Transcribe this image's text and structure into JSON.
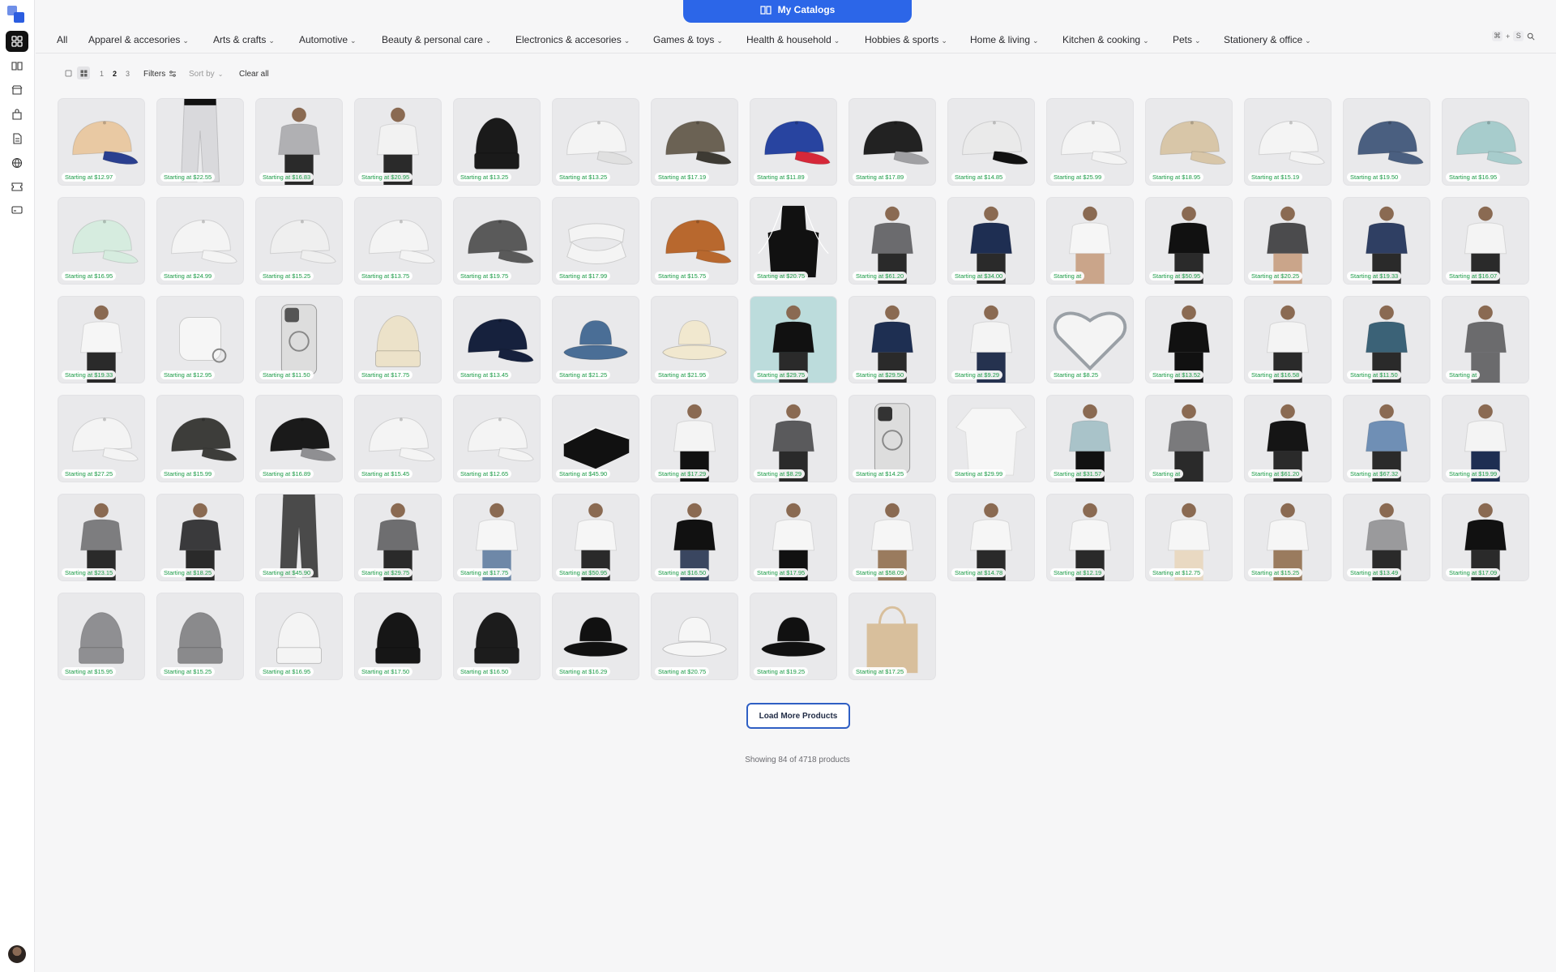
{
  "app": {
    "catalog_button": "My Catalogs"
  },
  "sidebar": {
    "icons": [
      "grid-icon",
      "book-icon",
      "store-icon",
      "bag-icon",
      "document-icon",
      "globe-icon",
      "ticket-icon",
      "card-icon"
    ],
    "active": "grid-icon"
  },
  "nav": {
    "categories": [
      {
        "label": "All",
        "dropdown": false
      },
      {
        "label": "Apparel & accesories",
        "dropdown": true
      },
      {
        "label": "Arts & crafts",
        "dropdown": true
      },
      {
        "label": "Automotive",
        "dropdown": true
      },
      {
        "label": "Beauty & personal care",
        "dropdown": true
      },
      {
        "label": "Electronics & accesories",
        "dropdown": true
      },
      {
        "label": "Games & toys",
        "dropdown": true
      },
      {
        "label": "Health & household",
        "dropdown": true
      },
      {
        "label": "Hobbies & sports",
        "dropdown": true
      },
      {
        "label": "Home & living",
        "dropdown": true
      },
      {
        "label": "Kitchen & cooking",
        "dropdown": true
      },
      {
        "label": "Pets",
        "dropdown": true
      },
      {
        "label": "Stationery & office",
        "dropdown": true
      }
    ],
    "shortcut": [
      "⌘",
      "+",
      "S"
    ]
  },
  "toolbar": {
    "pages": [
      "1",
      "2",
      "3"
    ],
    "active_page": "2",
    "filters_label": "Filters",
    "sort_label": "Sort by",
    "clear_label": "Clear all"
  },
  "products": [
    {
      "price": "Starting at $12.97",
      "kind": "cap",
      "c1": "#e9c9a3",
      "c2": "#2a3f8f"
    },
    {
      "price": "Starting at $22.55",
      "kind": "pants",
      "c1": "#d9d9dc",
      "c2": "#111"
    },
    {
      "price": "Starting at $16.83",
      "kind": "person",
      "c1": "#b0b0b3",
      "c2": "#2a2a2a"
    },
    {
      "price": "Starting at $20.95",
      "kind": "person",
      "c1": "#f2f2f2",
      "c2": "#2a2a2a"
    },
    {
      "price": "Starting at $13.25",
      "kind": "beanie",
      "c1": "#1a1a1a",
      "c2": "#1a1a1a"
    },
    {
      "price": "Starting at $13.25",
      "kind": "cap",
      "c1": "#f4f4f4",
      "c2": "#e0e0e0"
    },
    {
      "price": "Starting at $17.19",
      "kind": "cap",
      "c1": "#6b6254",
      "c2": "#3d3a33"
    },
    {
      "price": "Starting at $11.89",
      "kind": "cap",
      "c1": "#2844a0",
      "c2": "#d62839"
    },
    {
      "price": "Starting at $17.89",
      "kind": "cap",
      "c1": "#222",
      "c2": "#a0a0a3"
    },
    {
      "price": "Starting at $14.85",
      "kind": "cap",
      "c1": "#eaeaea",
      "c2": "#111"
    },
    {
      "price": "Starting at $25.99",
      "kind": "cap",
      "c1": "#f4f4f4",
      "c2": "#f4f4f4"
    },
    {
      "price": "Starting at $18.95",
      "kind": "cap",
      "c1": "#d8c6a8",
      "c2": "#d8c6a8"
    },
    {
      "price": "Starting at $15.19",
      "kind": "cap",
      "c1": "#f4f4f4",
      "c2": "#f4f4f4"
    },
    {
      "price": "Starting at $19.50",
      "kind": "cap",
      "c1": "#4a5f80",
      "c2": "#4a5f80"
    },
    {
      "price": "Starting at $16.95",
      "kind": "cap",
      "c1": "#a7cccc",
      "c2": "#a7cccc"
    },
    {
      "price": "Starting at $16.95",
      "kind": "cap",
      "c1": "#d6ecdf",
      "c2": "#d6ecdf"
    },
    {
      "price": "Starting at $24.99",
      "kind": "cap",
      "c1": "#f4f4f4",
      "c2": "#f4f4f4"
    },
    {
      "price": "Starting at $15.25",
      "kind": "cap",
      "c1": "#efefef",
      "c2": "#efefef"
    },
    {
      "price": "Starting at $13.75",
      "kind": "cap",
      "c1": "#f4f4f4",
      "c2": "#f4f4f4"
    },
    {
      "price": "Starting at $19.75",
      "kind": "cap",
      "c1": "#5a5a5a",
      "c2": "#5a5a5a"
    },
    {
      "price": "Starting at $17.99",
      "kind": "visor",
      "c1": "#f4f4f4",
      "c2": "#f4f4f4"
    },
    {
      "price": "Starting at $15.75",
      "kind": "cap",
      "c1": "#b8682e",
      "c2": "#b8682e"
    },
    {
      "price": "Starting at $20.75",
      "kind": "apron",
      "c1": "#111",
      "c2": "#111"
    },
    {
      "price": "Starting at $61.20",
      "kind": "person",
      "c1": "#6b6b6e",
      "c2": "#2a2a2a"
    },
    {
      "price": "Starting at $34.00",
      "kind": "person",
      "c1": "#1e2e52",
      "c2": "#2a2a2a"
    },
    {
      "price": "Starting at",
      "kind": "person",
      "c1": "#f6f6f6",
      "c2": "#caa58a"
    },
    {
      "price": "Starting at $50.95",
      "kind": "person",
      "c1": "#111",
      "c2": "#2a2a2a"
    },
    {
      "price": "Starting at $20.25",
      "kind": "person",
      "c1": "#4b4b4d",
      "c2": "#caa58a"
    },
    {
      "price": "Starting at $19.33",
      "kind": "person",
      "c1": "#2f3f63",
      "c2": "#2a2a2a"
    },
    {
      "price": "Starting at $16.07",
      "kind": "person",
      "c1": "#f4f4f4",
      "c2": "#2a2a2a"
    },
    {
      "price": "Starting at $19.33",
      "kind": "person",
      "c1": "#f6f6f6",
      "c2": "#2a2a2a"
    },
    {
      "price": "Starting at $12.95",
      "kind": "case",
      "c1": "#f6f6f6",
      "c2": "#f6f6f6"
    },
    {
      "price": "Starting at $11.50",
      "kind": "phone",
      "c1": "#555",
      "c2": "#ddd"
    },
    {
      "price": "Starting at $17.75",
      "kind": "beanie",
      "c1": "#ece2c9",
      "c2": "#ece2c9"
    },
    {
      "price": "Starting at $13.45",
      "kind": "cap",
      "c1": "#16213d",
      "c2": "#16213d"
    },
    {
      "price": "Starting at $21.25",
      "kind": "bucket",
      "c1": "#4a6e96",
      "c2": "#4a6e96"
    },
    {
      "price": "Starting at $21.95",
      "kind": "bucket",
      "c1": "#f1e8cf",
      "c2": "#f1e8cf"
    },
    {
      "price": "Starting at $29.75",
      "kind": "person",
      "c1": "#111",
      "c2": "#2a2a2a",
      "bg": "#bcdcdc"
    },
    {
      "price": "Starting at $29.50",
      "kind": "person",
      "c1": "#1e2f52",
      "c2": "#2a2a2a"
    },
    {
      "price": "Starting at $9.29",
      "kind": "person",
      "c1": "#f4f4f4",
      "c2": "#25324f"
    },
    {
      "price": "Starting at $8.25",
      "kind": "heart",
      "c1": "#f4f4f4",
      "c2": "#9aa0a6"
    },
    {
      "price": "Starting at $13.52",
      "kind": "person",
      "c1": "#111",
      "c2": "#111"
    },
    {
      "price": "Starting at $16.58",
      "kind": "person",
      "c1": "#f4f4f4",
      "c2": "#2a2a2a"
    },
    {
      "price": "Starting at $11.50",
      "kind": "person",
      "c1": "#3b6277",
      "c2": "#2a2a2a"
    },
    {
      "price": "Starting at",
      "kind": "person",
      "c1": "#6b6b6d",
      "c2": "#6b6b6d"
    },
    {
      "price": "Starting at $27.25",
      "kind": "cap",
      "c1": "#f4f4f4",
      "c2": "#f4f4f4"
    },
    {
      "price": "Starting at $15.99",
      "kind": "cap",
      "c1": "#3d3d3a",
      "c2": "#3d3d3a"
    },
    {
      "price": "Starting at $16.89",
      "kind": "cap",
      "c1": "#1a1a1a",
      "c2": "#8f8f92"
    },
    {
      "price": "Starting at $15.45",
      "kind": "cap",
      "c1": "#f4f4f4",
      "c2": "#f4f4f4"
    },
    {
      "price": "Starting at $12.65",
      "kind": "cap",
      "c1": "#f4f4f4",
      "c2": "#f4f4f4"
    },
    {
      "price": "Starting at $45.90",
      "kind": "blanket",
      "c1": "#111",
      "c2": "#f4f4f4"
    },
    {
      "price": "Starting at $17.29",
      "kind": "person",
      "c1": "#f4f4f4",
      "c2": "#111"
    },
    {
      "price": "Starting at $8.29",
      "kind": "person",
      "c1": "#5a5a5c",
      "c2": "#2a2a2a"
    },
    {
      "price": "Starting at $14.25",
      "kind": "phone",
      "c1": "#333",
      "c2": "#ddd"
    },
    {
      "price": "Starting at $29.99",
      "kind": "sweater",
      "c1": "#f6f6f6",
      "c2": "#f6f6f6"
    },
    {
      "price": "Starting at $31.57",
      "kind": "person",
      "c1": "#a9c3c9",
      "c2": "#111"
    },
    {
      "price": "Starting at",
      "kind": "person",
      "c1": "#7a7a7c",
      "c2": "#2a2a2a"
    },
    {
      "price": "Starting at $61.20",
      "kind": "person",
      "c1": "#151515",
      "c2": "#2a2a2a"
    },
    {
      "price": "Starting at $67.32",
      "kind": "person",
      "c1": "#6f8fb5",
      "c2": "#2a2a2a"
    },
    {
      "price": "Starting at $19.99",
      "kind": "person",
      "c1": "#f4f4f4",
      "c2": "#1e2e52"
    },
    {
      "price": "Starting at $23.15",
      "kind": "person",
      "c1": "#7d7d7f",
      "c2": "#2a2a2a"
    },
    {
      "price": "Starting at $18.25",
      "kind": "person",
      "c1": "#3a3a3c",
      "c2": "#2a2a2a"
    },
    {
      "price": "Starting at $45.90",
      "kind": "pants",
      "c1": "#4a4a4a",
      "c2": "#4a4a4a"
    },
    {
      "price": "Starting at $29.75",
      "kind": "person",
      "c1": "#6e6e70",
      "c2": "#2a2a2a"
    },
    {
      "price": "Starting at $17.75",
      "kind": "person",
      "c1": "#f6f6f6",
      "c2": "#6e88a8"
    },
    {
      "price": "Starting at $50.95",
      "kind": "person",
      "c1": "#f6f6f6",
      "c2": "#2a2a2a"
    },
    {
      "price": "Starting at $16.50",
      "kind": "person",
      "c1": "#111",
      "c2": "#3a4660"
    },
    {
      "price": "Starting at $17.95",
      "kind": "person",
      "c1": "#f6f6f6",
      "c2": "#111"
    },
    {
      "price": "Starting at $58.09",
      "kind": "person",
      "c1": "#f6f6f6",
      "c2": "#9a7b5e"
    },
    {
      "price": "Starting at $14.78",
      "kind": "person",
      "c1": "#f6f6f6",
      "c2": "#2a2a2a"
    },
    {
      "price": "Starting at $12.19",
      "kind": "person",
      "c1": "#f6f6f6",
      "c2": "#2a2a2a"
    },
    {
      "price": "Starting at $12.75",
      "kind": "person",
      "c1": "#f6f6f6",
      "c2": "#e9d9c2"
    },
    {
      "price": "Starting at $15.25",
      "kind": "person",
      "c1": "#f6f6f6",
      "c2": "#9a7b5e"
    },
    {
      "price": "Starting at $13.49",
      "kind": "person",
      "c1": "#9a9a9c",
      "c2": "#2a2a2a"
    },
    {
      "price": "Starting at $17.09",
      "kind": "person",
      "c1": "#111",
      "c2": "#2a2a2a"
    },
    {
      "price": "Starting at $15.95",
      "kind": "beanie",
      "c1": "#8f8f92",
      "c2": "#8f8f92"
    },
    {
      "price": "Starting at $15.25",
      "kind": "beanie",
      "c1": "#8a8a8c",
      "c2": "#8a8a8c"
    },
    {
      "price": "Starting at $16.95",
      "kind": "beanie",
      "c1": "#f4f4f4",
      "c2": "#f4f4f4"
    },
    {
      "price": "Starting at $17.50",
      "kind": "beanie",
      "c1": "#161616",
      "c2": "#161616"
    },
    {
      "price": "Starting at $16.50",
      "kind": "beanie",
      "c1": "#1c1c1c",
      "c2": "#1c1c1c"
    },
    {
      "price": "Starting at $16.29",
      "kind": "bucket",
      "c1": "#111",
      "c2": "#111"
    },
    {
      "price": "Starting at $20.75",
      "kind": "bucket",
      "c1": "#f6f6f6",
      "c2": "#f6f6f6"
    },
    {
      "price": "Starting at $19.25",
      "kind": "bucket",
      "c1": "#111",
      "c2": "#111"
    },
    {
      "price": "Starting at $17.25",
      "kind": "tote",
      "c1": "#d8bf9c",
      "c2": "#d8bf9c"
    }
  ],
  "footer": {
    "load_more": "Load More Products",
    "showing": "Showing 84 of 4718 products"
  },
  "colors": {
    "accent": "#2c66e8",
    "price": "#1a9b46"
  }
}
